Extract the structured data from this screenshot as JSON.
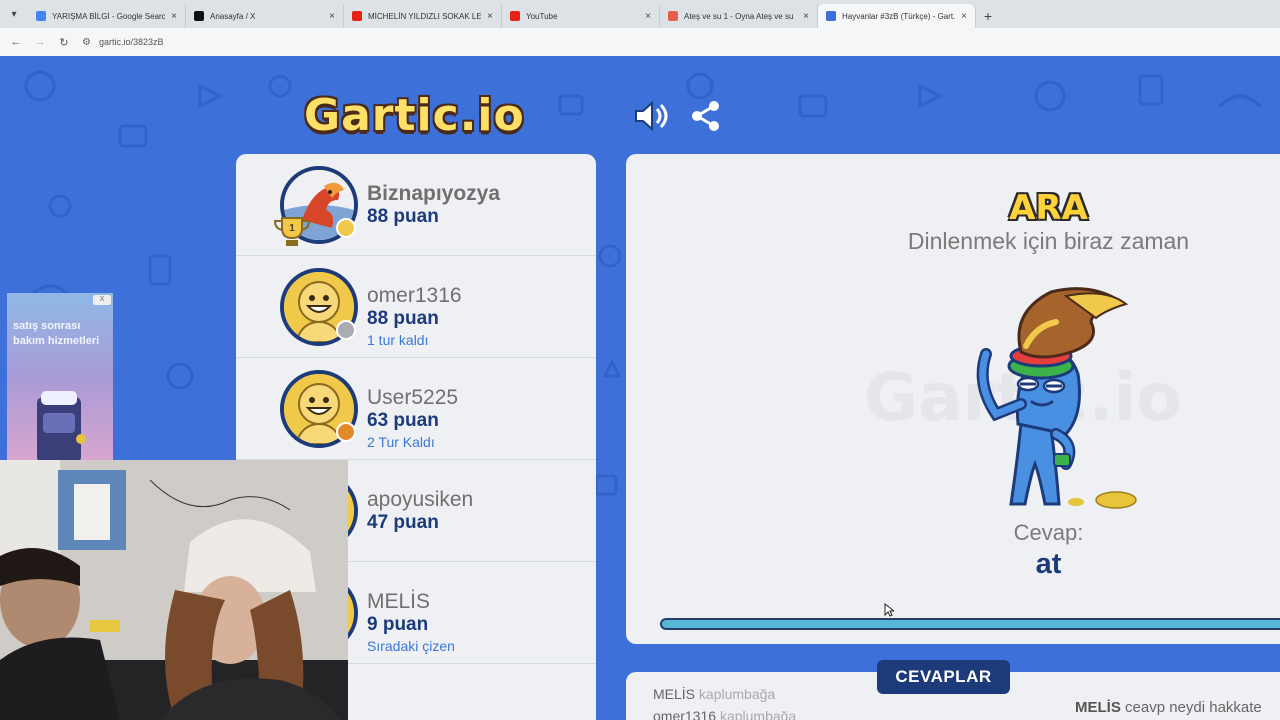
{
  "browser": {
    "tabs": [
      {
        "title": "YARIŞMA BİLGİ - Google Search",
        "favicon": "google-icon",
        "color": "#4285f4"
      },
      {
        "title": "Anasayfa / X",
        "favicon": "x-icon",
        "color": "#111111"
      },
      {
        "title": "MİCHELİN YILDIZLI SOKAK LEZ...",
        "favicon": "youtube-icon",
        "color": "#e62117"
      },
      {
        "title": "YouTube",
        "favicon": "youtube-icon",
        "color": "#e62117"
      },
      {
        "title": "Ateş ve su 1 - Oyna Ateş ve su",
        "favicon": "game-icon",
        "color": "#e85c4a"
      },
      {
        "title": "Hayvanlar #3zB (Türkçe) - Gart...",
        "favicon": "gartic-icon",
        "color": "#3d70d8"
      }
    ],
    "url": "gartic.io/3823zB"
  },
  "game": {
    "logo": "Gartic.io",
    "players": [
      {
        "name": "Biznapıyozya",
        "score": "88 puan",
        "status": "",
        "dot_color": "#f1c94a",
        "avatar": "dragon-avatar",
        "top": true
      },
      {
        "name": "omer1316",
        "score": "88 puan",
        "status": "1 tur kaldı",
        "dot_color": "#a9adb3",
        "avatar": "smiley-avatar",
        "top": false
      },
      {
        "name": "User5225",
        "score": "63 puan",
        "status": "2 Tur Kaldı",
        "dot_color": "#e48a2a",
        "avatar": "smiley-avatar",
        "top": false
      },
      {
        "name": "apoyusiken",
        "score": "47 puan",
        "status": "",
        "dot_color": "",
        "avatar": "smiley-avatar",
        "top": false
      },
      {
        "name": "MELİS",
        "score": "9 puan",
        "status": "Sıradaki çizen",
        "dot_color": "",
        "avatar": "smiley-avatar",
        "top": false
      }
    ],
    "trophy_rank": "1",
    "break_title": "ARA",
    "break_subtitle": "Dinlenmek için biraz zaman",
    "answer_label": "Cevap:",
    "answer_value": "at",
    "timer_fraction": 1.0,
    "answers_button": "CEVAPLAR",
    "answer_rows": [
      {
        "user": "MELİS",
        "word": "kaplumbağa"
      },
      {
        "user": "omer1316",
        "word": "kaplumbağa"
      }
    ],
    "chat": {
      "user": "MELİS",
      "text": "ceavp neydi hakkate"
    }
  },
  "ad": {
    "text": "satış sonrası bakım hizmetleri",
    "close": "X"
  },
  "colors": {
    "page_bg": "#3d70d8",
    "navy": "#1d3b7a",
    "accent_blue": "#3b78d6",
    "timer": "#57b7d6"
  }
}
